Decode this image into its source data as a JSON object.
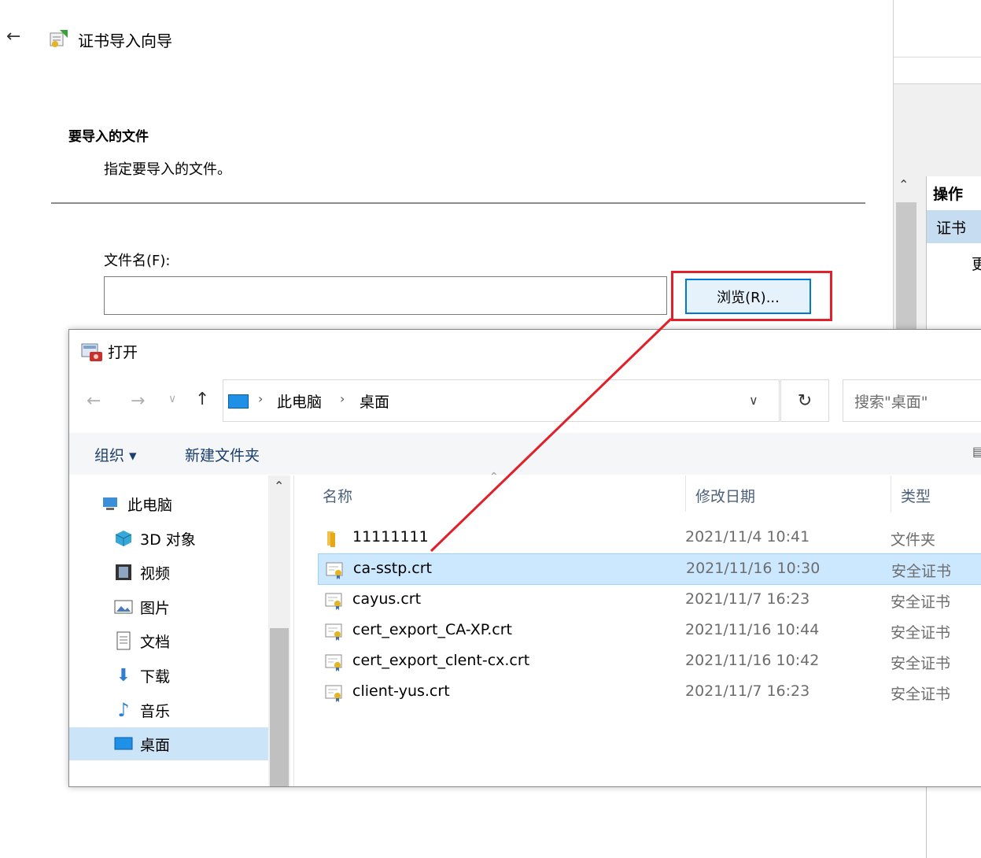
{
  "wizard": {
    "back_icon": "back-arrow-icon",
    "app_icon": "certificate-wizard-icon",
    "title": "证书导入向导",
    "section_title": "要导入的文件",
    "section_desc": "指定要导入的文件。",
    "file_label": "文件名(F):",
    "file_value": "",
    "browse_label": "浏览(R)..."
  },
  "right_panel": {
    "actions_title": "操作",
    "cert_item": "证书",
    "more_item": "更"
  },
  "dialog": {
    "title": "打开",
    "address": {
      "pc": "此电脑",
      "folder": "桌面"
    },
    "search_placeholder": "搜索\"桌面\"",
    "toolbar": {
      "organize": "组织 ▾",
      "new_folder": "新建文件夹"
    },
    "nav_items": [
      {
        "label": "此电脑",
        "icon": "pc-icon"
      },
      {
        "label": "3D 对象",
        "icon": "3d-objects-icon"
      },
      {
        "label": "视频",
        "icon": "video-icon"
      },
      {
        "label": "图片",
        "icon": "pictures-icon"
      },
      {
        "label": "文档",
        "icon": "documents-icon"
      },
      {
        "label": "下载",
        "icon": "download-icon"
      },
      {
        "label": "音乐",
        "icon": "music-icon"
      },
      {
        "label": "桌面",
        "icon": "desktop-icon",
        "selected": true
      }
    ],
    "columns": {
      "name": "名称",
      "modified": "修改日期",
      "type": "类型"
    },
    "files": [
      {
        "name": "11111111",
        "date": "2021/11/4 10:41",
        "type": "文件夹",
        "icon": "folder-icon"
      },
      {
        "name": "ca-sstp.crt",
        "date": "2021/11/16 10:30",
        "type": "安全证书",
        "icon": "certificate-file-icon",
        "selected": true
      },
      {
        "name": "cayus.crt",
        "date": "2021/11/7 16:23",
        "type": "安全证书",
        "icon": "certificate-file-icon"
      },
      {
        "name": "cert_export_CA-XP.crt",
        "date": "2021/11/16 10:44",
        "type": "安全证书",
        "icon": "certificate-file-icon"
      },
      {
        "name": "cert_export_clent-cx.crt",
        "date": "2021/11/16 10:42",
        "type": "安全证书",
        "icon": "certificate-file-icon"
      },
      {
        "name": "client-yus.crt",
        "date": "2021/11/7 16:23",
        "type": "安全证书",
        "icon": "certificate-file-icon"
      }
    ]
  },
  "colors": {
    "highlight": "#e0202a",
    "selection": "#cce8ff",
    "accent": "#0078d7"
  }
}
